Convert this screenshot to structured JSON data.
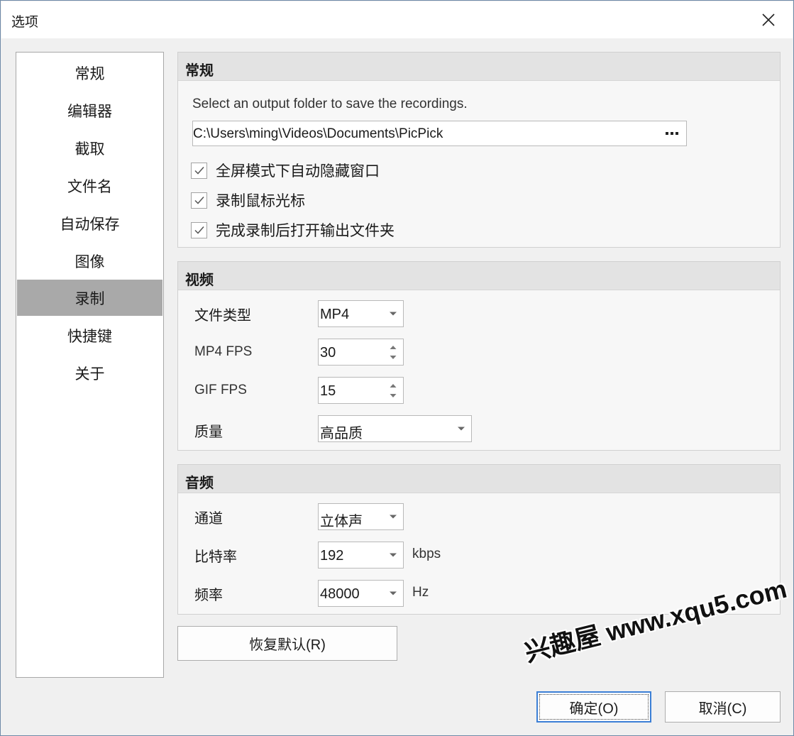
{
  "window": {
    "title": "选项"
  },
  "sidebar": {
    "items": [
      {
        "label": "常规"
      },
      {
        "label": "编辑器"
      },
      {
        "label": "截取"
      },
      {
        "label": "文件名"
      },
      {
        "label": "自动保存"
      },
      {
        "label": "图像"
      },
      {
        "label": "录制",
        "active": true
      },
      {
        "label": "快捷键"
      },
      {
        "label": "关于"
      }
    ]
  },
  "general": {
    "header": "常规",
    "folder_prompt": "Select an output folder to save the recordings.",
    "folder_path": "C:\\Users\\ming\\Videos\\Documents\\PicPick",
    "browse_label": "···",
    "checks": [
      {
        "label": "全屏模式下自动隐藏窗口",
        "checked": true
      },
      {
        "label": "录制鼠标光标",
        "checked": true
      },
      {
        "label": "完成录制后打开输出文件夹",
        "checked": true
      }
    ]
  },
  "video": {
    "header": "视频",
    "file_type_label": "文件类型",
    "file_type_value": "MP4",
    "mp4_fps_label": "MP4 FPS",
    "mp4_fps_value": "30",
    "gif_fps_label": "GIF FPS",
    "gif_fps_value": "15",
    "quality_label": "质量",
    "quality_value": "高品质"
  },
  "audio": {
    "header": "音频",
    "channel_label": "通道",
    "channel_value": "立体声",
    "bitrate_label": "比特率",
    "bitrate_value": "192",
    "bitrate_unit": "kbps",
    "frequency_label": "频率",
    "frequency_value": "48000",
    "frequency_unit": "Hz"
  },
  "buttons": {
    "restore_defaults": "恢复默认(R)",
    "ok": "确定(O)",
    "cancel": "取消(C)"
  },
  "watermark": "兴趣屋 www.xqu5.com"
}
